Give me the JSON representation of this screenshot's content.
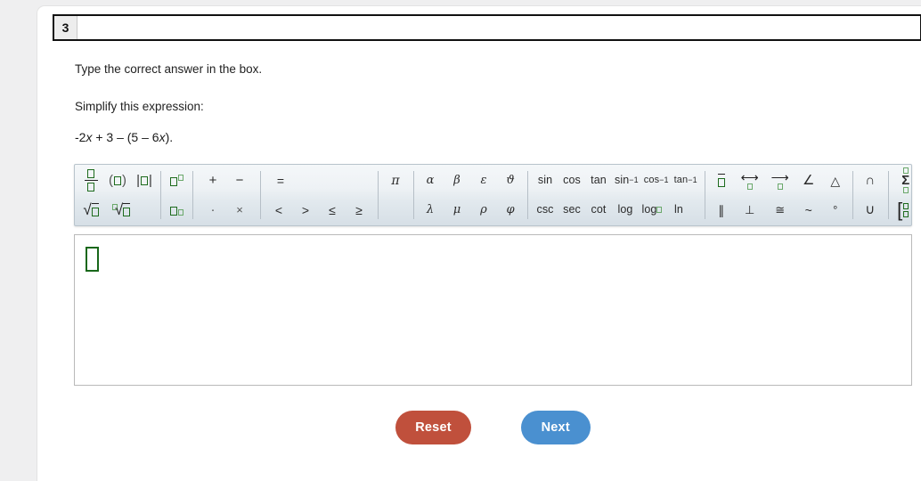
{
  "question": {
    "number": "3",
    "instruction": "Type the correct answer in the box.",
    "prompt": "Simplify this expression:",
    "expression_prefix": "-2",
    "expression_var1": "x",
    "expression_mid": " + 3 – (5 – 6",
    "expression_var2": "x",
    "expression_suffix": ")."
  },
  "toolbar": {
    "groups": [
      {
        "name": "structures",
        "rows": [
          [
            {
              "name": "fraction-button",
              "label": "fraction"
            },
            {
              "name": "parentheses-button",
              "label": "(□)"
            },
            {
              "name": "absolute-value-button",
              "label": "|□|"
            }
          ],
          [
            {
              "name": "square-root-button",
              "label": "√□"
            },
            {
              "name": "nth-root-button",
              "label": "ⁿ√□"
            }
          ]
        ]
      },
      {
        "name": "exponents",
        "rows": [
          [
            {
              "name": "exponent-button",
              "label": "□^□"
            }
          ],
          [
            {
              "name": "subscript-button",
              "label": "□_□"
            }
          ]
        ]
      },
      {
        "name": "operators",
        "rows": [
          [
            {
              "name": "plus-button",
              "label": "+"
            },
            {
              "name": "minus-button",
              "label": "−"
            }
          ],
          [
            {
              "name": "dot-multiply-button",
              "label": "·"
            },
            {
              "name": "times-button",
              "label": "×"
            }
          ]
        ]
      },
      {
        "name": "relations",
        "rows": [
          [
            {
              "name": "equals-button",
              "label": "="
            }
          ],
          [
            {
              "name": "less-than-button",
              "label": "<"
            },
            {
              "name": "greater-than-button",
              "label": ">"
            },
            {
              "name": "less-than-equal-button",
              "label": "≤"
            },
            {
              "name": "greater-than-equal-button",
              "label": "≥"
            }
          ]
        ]
      },
      {
        "name": "pi",
        "rows": [
          [
            {
              "name": "pi-button",
              "label": "π"
            }
          ],
          []
        ]
      },
      {
        "name": "greek",
        "rows": [
          [
            {
              "name": "alpha-button",
              "label": "α"
            },
            {
              "name": "beta-button",
              "label": "β"
            },
            {
              "name": "epsilon-button",
              "label": "ε"
            },
            {
              "name": "theta-button",
              "label": "ϑ"
            }
          ],
          [
            {
              "name": "lambda-button",
              "label": "λ"
            },
            {
              "name": "mu-button",
              "label": "μ"
            },
            {
              "name": "rho-button",
              "label": "ρ"
            },
            {
              "name": "phi-button",
              "label": "φ"
            }
          ]
        ]
      },
      {
        "name": "trigonometry",
        "rows": [
          [
            {
              "name": "sin-button",
              "label": "sin"
            },
            {
              "name": "cos-button",
              "label": "cos"
            },
            {
              "name": "tan-button",
              "label": "tan"
            },
            {
              "name": "arcsin-button",
              "label": "sin⁻¹"
            },
            {
              "name": "arccos-button",
              "label": "cos⁻¹"
            },
            {
              "name": "arctan-button",
              "label": "tan⁻¹"
            }
          ],
          [
            {
              "name": "csc-button",
              "label": "csc"
            },
            {
              "name": "sec-button",
              "label": "sec"
            },
            {
              "name": "cot-button",
              "label": "cot"
            },
            {
              "name": "log-button",
              "label": "log"
            },
            {
              "name": "log-base-button",
              "label": "log□"
            },
            {
              "name": "ln-button",
              "label": "ln"
            }
          ]
        ]
      },
      {
        "name": "geometry",
        "rows": [
          [
            {
              "name": "overline-button",
              "label": "□ overline"
            },
            {
              "name": "line-button",
              "label": "↔"
            },
            {
              "name": "ray-button",
              "label": "→"
            },
            {
              "name": "angle-button",
              "label": "∠"
            },
            {
              "name": "triangle-button",
              "label": "△"
            }
          ],
          [
            {
              "name": "parallel-button",
              "label": "∥"
            },
            {
              "name": "perpendicular-button",
              "label": "⊥"
            },
            {
              "name": "congruent-button",
              "label": "≅"
            },
            {
              "name": "similar-button",
              "label": "~"
            },
            {
              "name": "degree-button",
              "label": "°"
            }
          ]
        ]
      },
      {
        "name": "sets",
        "rows": [
          [
            {
              "name": "intersection-button",
              "label": "∩"
            }
          ],
          [
            {
              "name": "union-button",
              "label": "∪"
            }
          ]
        ]
      },
      {
        "name": "advanced",
        "rows": [
          [
            {
              "name": "summation-button",
              "label": "Σ"
            }
          ],
          [
            {
              "name": "matrix-button",
              "label": "matrix"
            }
          ]
        ]
      }
    ]
  },
  "answer": {
    "value": "",
    "placeholder_name": "empty-math-box"
  },
  "actions": {
    "reset_label": "Reset",
    "next_label": "Next"
  },
  "colors": {
    "reset": "#c0503c",
    "next": "#4a90d0",
    "placeholder_green": "#18671a",
    "toolbar_bg": "#e6edf2"
  }
}
